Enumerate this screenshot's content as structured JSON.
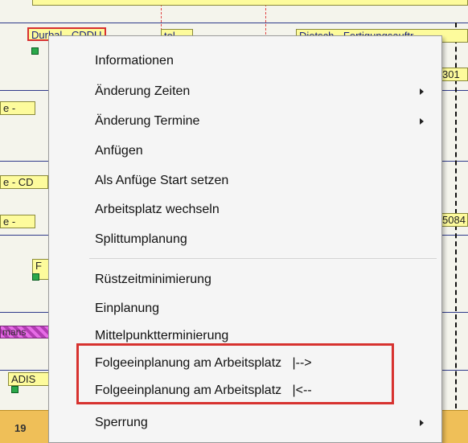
{
  "gantt": {
    "bars": [
      {
        "label": "Durbal - CDDU"
      },
      {
        "label": "tel"
      },
      {
        "label": "Dietsch - Fertigungsauftr"
      },
      {
        "label": "301"
      },
      {
        "label": "e -"
      },
      {
        "label": "e - CD"
      },
      {
        "label": "e -"
      },
      {
        "label": "5084"
      },
      {
        "label": "F"
      },
      {
        "label": "ADIS"
      },
      {
        "label": "mans"
      }
    ],
    "footer_date": "19"
  },
  "context_menu": {
    "items": [
      {
        "label": "Informationen"
      },
      {
        "label": "Änderung Zeiten",
        "has_submenu": true
      },
      {
        "label": "Änderung Termine",
        "has_submenu": true
      },
      {
        "label": "Anfügen"
      },
      {
        "label": "Als Anfüge Start setzen"
      },
      {
        "label": "Arbeitsplatz wechseln"
      },
      {
        "label": "Splittumplanung"
      },
      {
        "label": "Rüstzeitminimierung"
      },
      {
        "label": "Einplanung"
      },
      {
        "label": "Mittelpunktterminierung"
      },
      {
        "label": "Folgeeinplanung am Arbeitsplatz   |-->"
      },
      {
        "label": "Folgeeinplanung am Arbeitsplatz   |<--"
      },
      {
        "label": "Sperrung",
        "has_submenu": true
      }
    ],
    "highlight_color": "#d7322f"
  }
}
